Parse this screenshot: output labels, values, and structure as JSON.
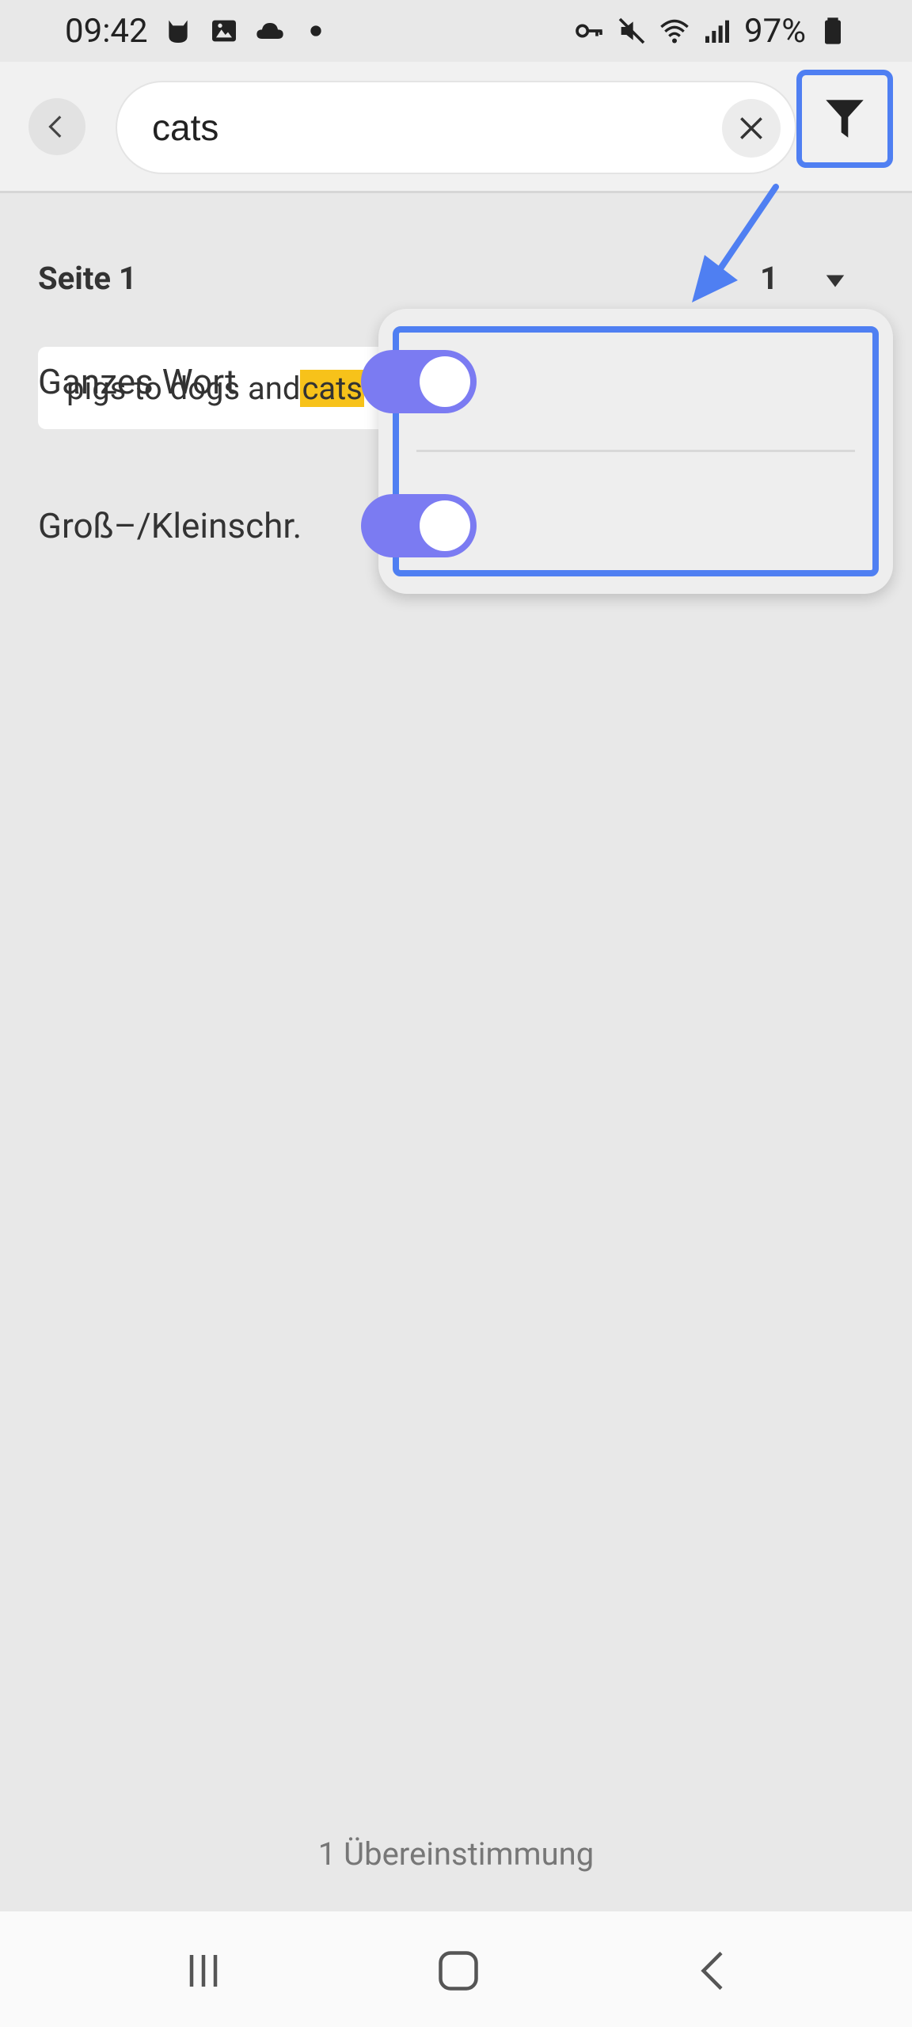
{
  "status_bar": {
    "time": "09:42",
    "battery": "97%",
    "left_icons": [
      "cat-icon",
      "image-icon",
      "cloud-icon",
      "dot-icon"
    ],
    "right_icons": [
      "key-icon",
      "mute-icon",
      "wifi-icon",
      "signal-icon",
      "battery-icon"
    ]
  },
  "search": {
    "query": "cats"
  },
  "results": {
    "page_label": "Seite 1",
    "page_count": "1",
    "snippet_prefix": "pigs to dogs and ",
    "snippet_match": "cats"
  },
  "filter_popup": {
    "whole_word_label": "Ganzes Wort",
    "whole_word_on": true,
    "case_label": "Groß–/Kleinschr.",
    "case_on": true
  },
  "footer": {
    "match_count": "1 Übereinstimmung"
  },
  "colors": {
    "accent_outline": "#4f7ff2",
    "toggle_on": "#7b7bf2",
    "highlight": "#f7c21a"
  }
}
